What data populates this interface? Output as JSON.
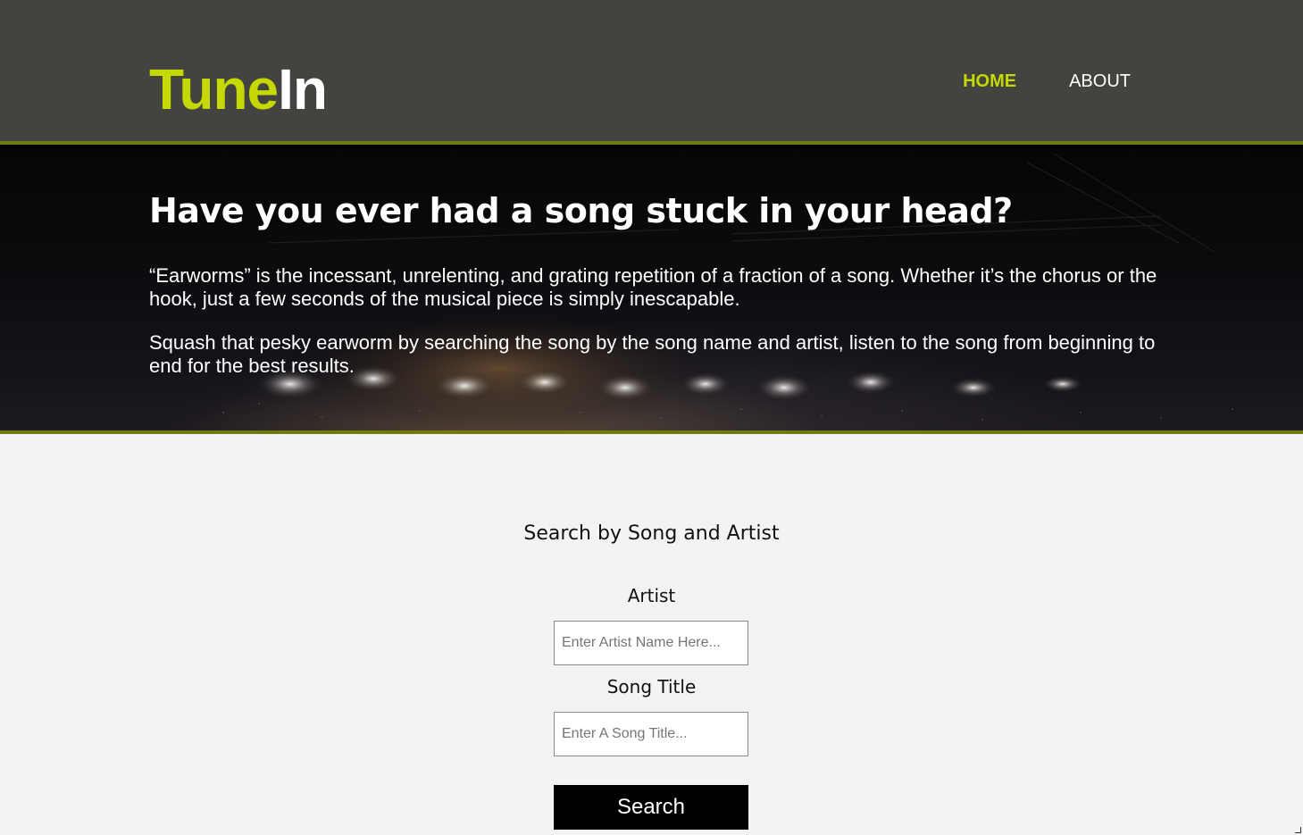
{
  "brand": {
    "logo_part1": "Tune",
    "logo_part2": "In",
    "accent_color": "#c5d900",
    "header_bg": "#434440",
    "border_color": "#6f7a10"
  },
  "nav": {
    "items": [
      {
        "label": "HOME",
        "active": true
      },
      {
        "label": "ABOUT",
        "active": false
      }
    ]
  },
  "hero": {
    "title": "Have you ever had a song stuck in your head?",
    "paragraph1": "“Earworms” is the incessant, unrelenting, and grating repetition of a fraction of a song. Whether it’s the chorus or the hook, just a few seconds of the musical piece is simply inescapable.",
    "paragraph2": "Squash that pesky earworm by searching the song by the song name and artist, listen to the song from beginning to end for the best results.",
    "background_image": "concert-stage-lights"
  },
  "search": {
    "heading": "Search by Song and Artist",
    "artist_label": "Artist",
    "artist_placeholder": "Enter Artist Name Here...",
    "artist_value": "",
    "song_label": "Song Title",
    "song_placeholder": "Enter A Song Title...",
    "song_value": "",
    "button_label": "Search"
  }
}
